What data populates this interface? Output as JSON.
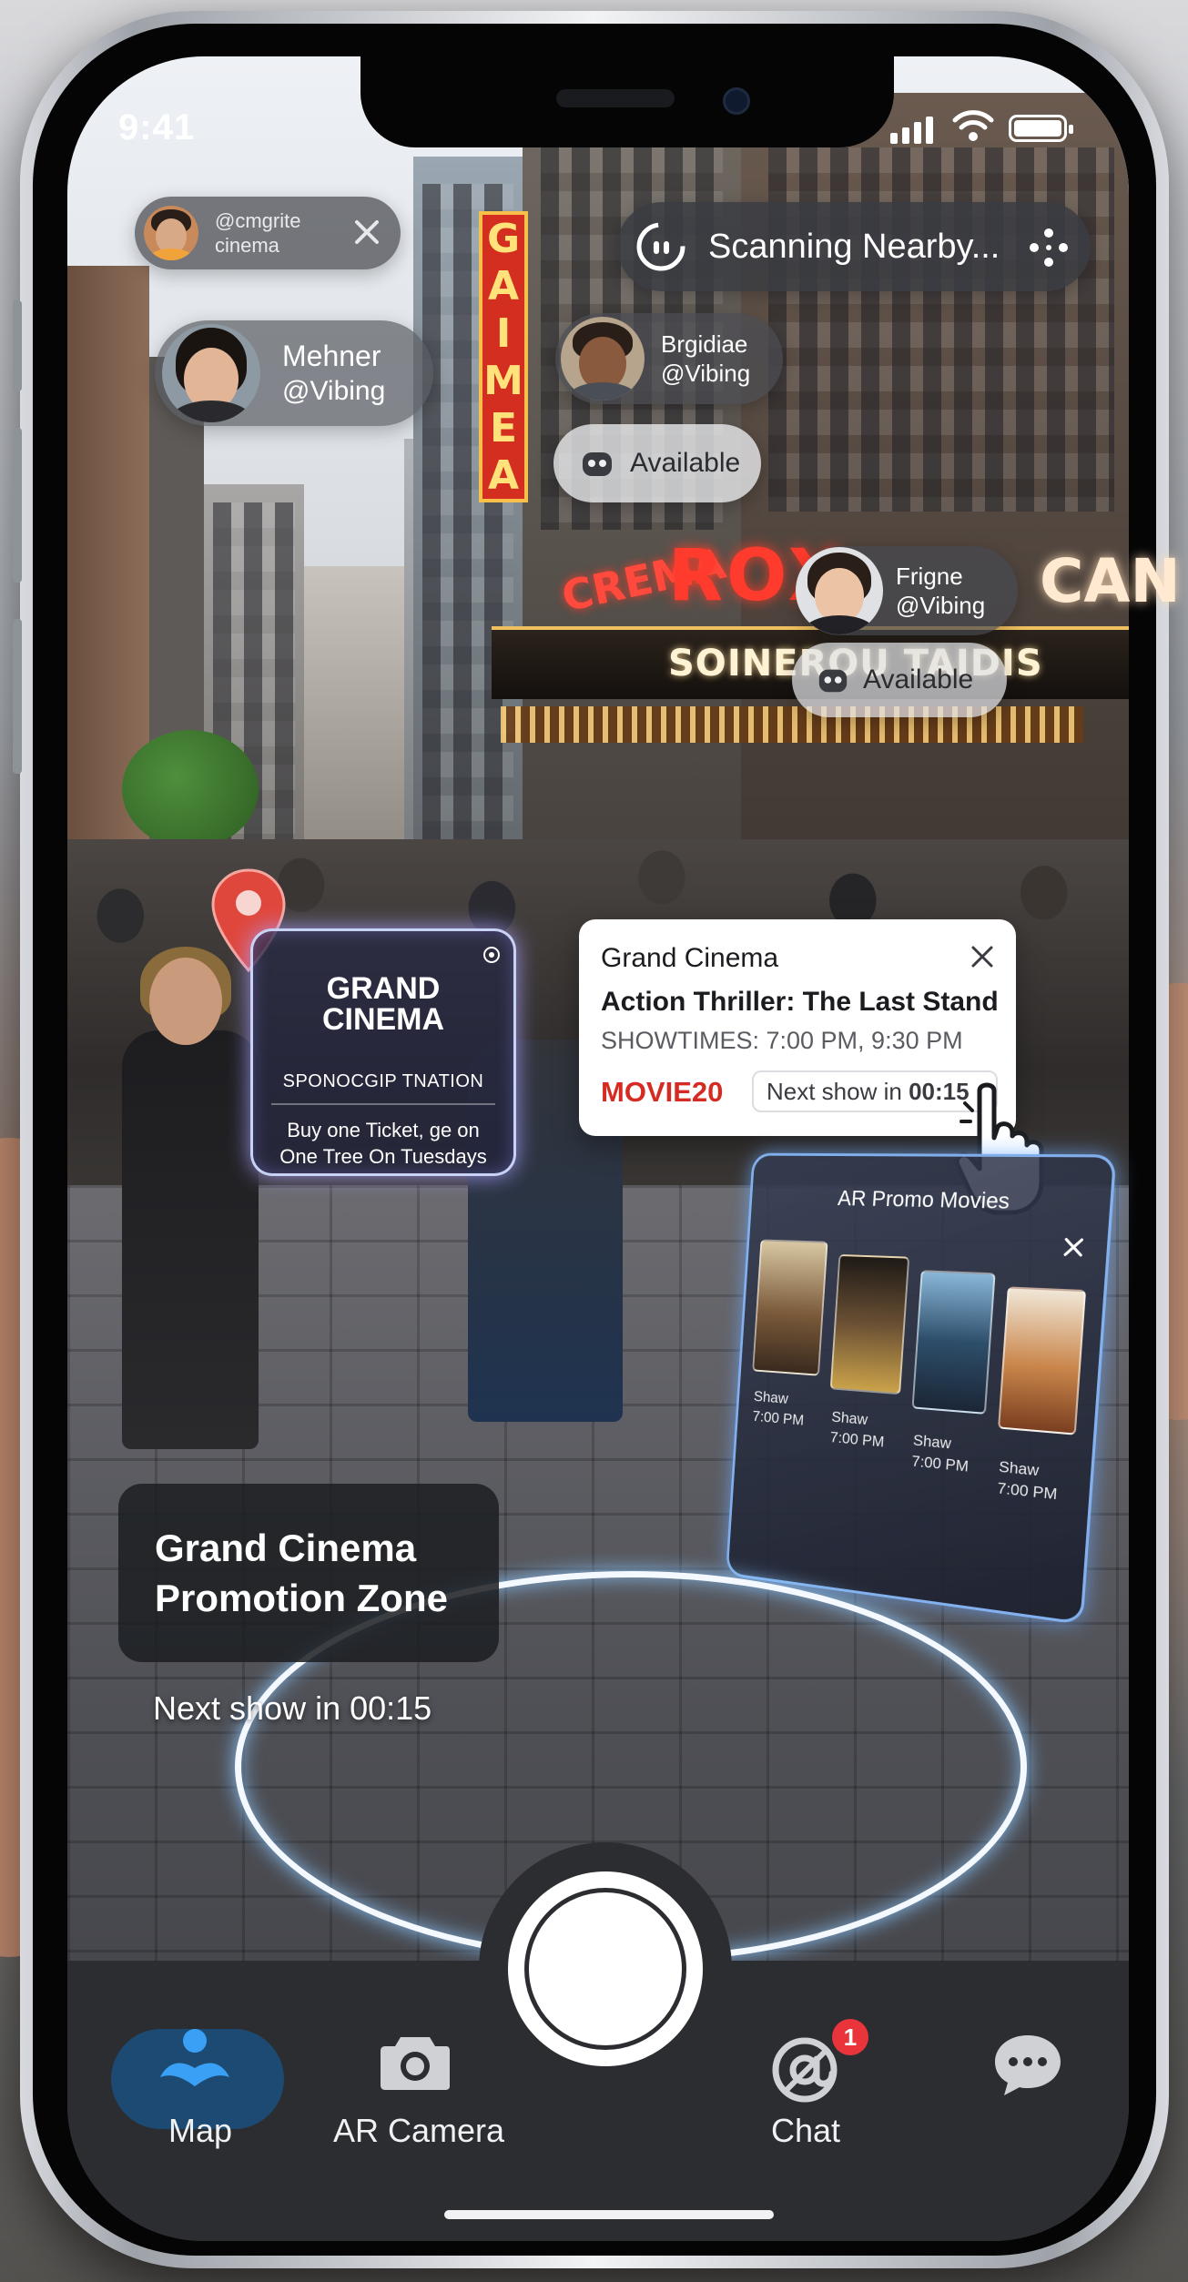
{
  "status_bar": {
    "time": "9:41",
    "battery_level": 1.0,
    "signal_bars": 4
  },
  "pills": {
    "top_left": {
      "line1": "@cmgrite",
      "line2": "cinema"
    },
    "mehner": {
      "name": "Mehner",
      "handle": "@Vibing"
    },
    "scanning": {
      "label": "Scanning Nearby..."
    },
    "brgidiae": {
      "name": "Brgidiae",
      "handle": "@Vibing"
    },
    "available_1": {
      "label": "Available"
    },
    "frigne": {
      "name": "Frigne",
      "handle": "@Vibing"
    },
    "available_2": {
      "label": "Available"
    }
  },
  "signage": {
    "vertical": [
      "G",
      "A",
      "I",
      "M",
      "E",
      "A"
    ],
    "neon_main": "ROX",
    "neon_side": "CREMA",
    "neon_right": "CAN",
    "marquee": "SOINEROU TAIDIS"
  },
  "promo_card": {
    "title_line1": "GRAND",
    "title_line2": "CINEMA",
    "sponsor": "SPONOCGIP TNATION",
    "offer": "Buy one Ticket, ge on One Tree On Tuesdays"
  },
  "movie_card": {
    "venue": "Grand Cinema",
    "title": "Action Thriller: The Last Stand",
    "showtimes": "SHOWTIMES: 7:00 PM, 9:30 PM",
    "promo_code": "MOVIE20",
    "next_show_prefix": "Next show in",
    "next_show_time": "00:15"
  },
  "ar_panel": {
    "title": "AR Promo Movies",
    "posters": [
      {
        "label": "Shaw",
        "time": "7:00 PM",
        "color": "#7a5a3a"
      },
      {
        "label": "Shaw",
        "time": "7:00 PM",
        "color": "#3a3024"
      },
      {
        "label": "Shaw",
        "time": "7:00 PM",
        "color": "#2d4e6a"
      },
      {
        "label": "Shaw",
        "time": "7:00 PM",
        "color": "#c9854a"
      }
    ]
  },
  "zone": {
    "title": "Grand Cinema Promotion Zone",
    "next_show": "Next show in 00:15"
  },
  "tabbar": {
    "map": "Map",
    "camera": "AR Camera",
    "chat": "Chat",
    "chat_badge": "1"
  },
  "colors": {
    "accent_blue": "#3aa0f5",
    "promo_red": "#d62b22",
    "badge_red": "#e8343a",
    "ring_glow": "#8cc8ff"
  }
}
